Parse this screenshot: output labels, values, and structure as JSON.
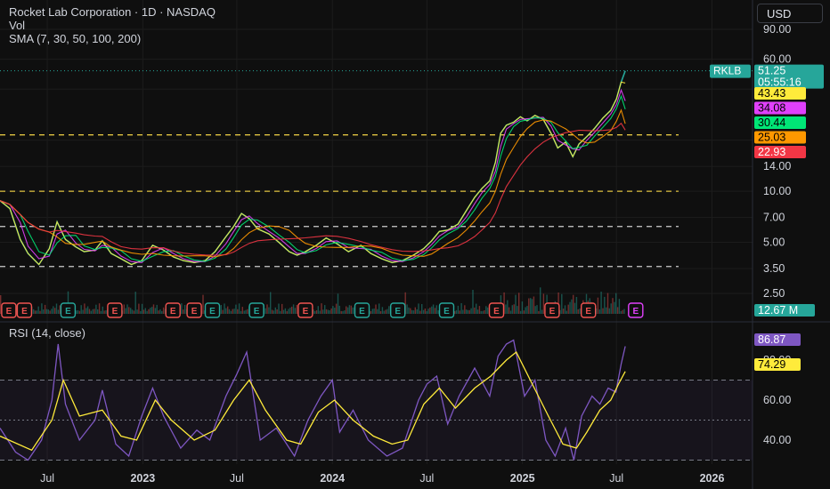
{
  "header": {
    "title": "Rocket Lab Corporation · 1D · NASDAQ",
    "vol_label": "Vol",
    "sma_label": "SMA (7, 30, 50, 100, 200)",
    "currency": "USD"
  },
  "rsi_title": "RSI (14, close)",
  "colors": {
    "up": "#26a69a",
    "down": "#ef5350",
    "sma7": "#ffeb3b",
    "sma30": "#e040fb",
    "sma50": "#00e676",
    "sma100": "#ff9800",
    "sma200": "#f23645",
    "rsi": "#7e57c2",
    "rsi_ma": "#ffeb3b"
  },
  "chart_data": [
    {
      "type": "line",
      "log_scale": true,
      "price_ticks": [
        "90.00",
        "60.00",
        "40.00",
        "20.00",
        "14.00",
        "10.00",
        "7.00",
        "5.00",
        "3.50",
        "2.50"
      ],
      "price_tick_values": [
        90,
        60,
        40,
        20,
        14,
        10,
        7,
        5,
        3.5,
        2.5
      ],
      "ylim": [
        2.5,
        90
      ],
      "x_ticks": [
        "Jul",
        "2023",
        "Jul",
        "2024",
        "Jul",
        "2025",
        "Jul",
        "2026"
      ],
      "x_tick_dates": [
        "2022-07-01",
        "2023-01-01",
        "2023-07-01",
        "2024-01-01",
        "2024-07-01",
        "2025-01-01",
        "2025-07-01",
        "2026-01-01"
      ],
      "xlim": [
        "2022-04-01",
        "2026-03-20"
      ],
      "series": [
        {
          "name": "RKLB",
          "points": [
            [
              "2022-04-01",
              8.8
            ],
            [
              "2022-04-20",
              7.9
            ],
            [
              "2022-05-10",
              5.2
            ],
            [
              "2022-05-25",
              4.3
            ],
            [
              "2022-06-15",
              3.7
            ],
            [
              "2022-07-05",
              4.6
            ],
            [
              "2022-07-20",
              6.6
            ],
            [
              "2022-08-05",
              5.2
            ],
            [
              "2022-08-25",
              4.7
            ],
            [
              "2022-09-10",
              4.4
            ],
            [
              "2022-10-01",
              4.5
            ],
            [
              "2022-10-15",
              5.1
            ],
            [
              "2022-11-01",
              4.3
            ],
            [
              "2022-11-20",
              4.0
            ],
            [
              "2022-12-10",
              3.7
            ],
            [
              "2022-12-30",
              3.9
            ],
            [
              "2023-01-20",
              4.8
            ],
            [
              "2023-02-10",
              4.5
            ],
            [
              "2023-03-01",
              4.1
            ],
            [
              "2023-03-20",
              3.9
            ],
            [
              "2023-04-10",
              3.8
            ],
            [
              "2023-05-01",
              3.9
            ],
            [
              "2023-05-20",
              4.4
            ],
            [
              "2023-06-10",
              5.4
            ],
            [
              "2023-06-25",
              6.2
            ],
            [
              "2023-07-10",
              7.4
            ],
            [
              "2023-07-25",
              6.9
            ],
            [
              "2023-08-10",
              6.0
            ],
            [
              "2023-09-01",
              5.6
            ],
            [
              "2023-09-20",
              5.0
            ],
            [
              "2023-10-10",
              4.4
            ],
            [
              "2023-10-25",
              4.2
            ],
            [
              "2023-11-10",
              4.4
            ],
            [
              "2023-12-01",
              4.8
            ],
            [
              "2023-12-20",
              5.3
            ],
            [
              "2024-01-10",
              4.9
            ],
            [
              "2024-02-01",
              4.4
            ],
            [
              "2024-02-25",
              4.8
            ],
            [
              "2024-03-15",
              4.3
            ],
            [
              "2024-04-05",
              4.0
            ],
            [
              "2024-04-25",
              3.8
            ],
            [
              "2024-05-15",
              3.9
            ],
            [
              "2024-06-05",
              4.2
            ],
            [
              "2024-06-25",
              4.6
            ],
            [
              "2024-07-10",
              5.1
            ],
            [
              "2024-07-25",
              5.8
            ],
            [
              "2024-08-10",
              5.9
            ],
            [
              "2024-08-30",
              6.4
            ],
            [
              "2024-09-15",
              7.7
            ],
            [
              "2024-10-01",
              9.2
            ],
            [
              "2024-10-15",
              10.4
            ],
            [
              "2024-10-30",
              11.5
            ],
            [
              "2024-11-10",
              14.8
            ],
            [
              "2024-11-20",
              22.0
            ],
            [
              "2024-12-01",
              24.5
            ],
            [
              "2024-12-15",
              25.5
            ],
            [
              "2024-12-28",
              27.5
            ],
            [
              "2025-01-10",
              26.0
            ],
            [
              "2025-01-25",
              28.0
            ],
            [
              "2025-02-10",
              26.5
            ],
            [
              "2025-02-25",
              22.0
            ],
            [
              "2025-03-10",
              18.0
            ],
            [
              "2025-03-25",
              19.5
            ],
            [
              "2025-04-08",
              16.0
            ],
            [
              "2025-04-20",
              19.0
            ],
            [
              "2025-05-05",
              21.0
            ],
            [
              "2025-05-20",
              23.5
            ],
            [
              "2025-06-05",
              27.0
            ],
            [
              "2025-06-20",
              30.0
            ],
            [
              "2025-07-01",
              35.0
            ],
            [
              "2025-07-10",
              44.0
            ],
            [
              "2025-07-18",
              51.25
            ]
          ]
        }
      ],
      "sma_labels": [
        {
          "name": "SMA 7",
          "text": "43.43",
          "value": 43.43
        },
        {
          "name": "SMA 30",
          "text": "34.08",
          "value": 34.08
        },
        {
          "name": "SMA 50",
          "text": "30.44",
          "value": 30.44
        },
        {
          "name": "SMA 100",
          "text": "25.03",
          "value": 25.03
        },
        {
          "name": "SMA 200",
          "text": "22.93",
          "value": 22.93
        }
      ],
      "last_price": {
        "symbol": "RKLB",
        "text": "51.25",
        "value": 51.25,
        "countdown": "05:55:16"
      },
      "support_levels": [
        21.5,
        10.0,
        6.2,
        3.6
      ],
      "volume_label": "12.67 M",
      "earnings_markers": [
        {
          "date": "2022-04-18",
          "label": "E",
          "type": "down"
        },
        {
          "date": "2022-05-18",
          "label": "E",
          "type": "down"
        },
        {
          "date": "2022-08-10",
          "label": "E",
          "type": "up"
        },
        {
          "date": "2022-11-08",
          "label": "E",
          "type": "down"
        },
        {
          "date": "2023-02-28",
          "label": "E",
          "type": "down"
        },
        {
          "date": "2023-04-10",
          "label": "E",
          "type": "down"
        },
        {
          "date": "2023-05-15",
          "label": "E",
          "type": "up"
        },
        {
          "date": "2023-08-08",
          "label": "E",
          "type": "up"
        },
        {
          "date": "2023-11-10",
          "label": "E",
          "type": "down"
        },
        {
          "date": "2024-02-27",
          "label": "E",
          "type": "up"
        },
        {
          "date": "2024-05-06",
          "label": "E",
          "type": "up"
        },
        {
          "date": "2024-08-08",
          "label": "E",
          "type": "up"
        },
        {
          "date": "2024-11-12",
          "label": "E",
          "type": "down"
        },
        {
          "date": "2025-02-27",
          "label": "E",
          "type": "down"
        },
        {
          "date": "2025-05-08",
          "label": "E",
          "type": "down"
        },
        {
          "date": "2025-08-07",
          "label": "E",
          "type": "next"
        }
      ]
    },
    {
      "type": "line",
      "title": "RSI (14, close)",
      "rsi_ticks": [
        "80.00",
        "60.00",
        "40.00"
      ],
      "rsi_tick_values": [
        80,
        60,
        40
      ],
      "ylim": [
        28,
        92
      ],
      "bands": [
        70,
        50,
        30
      ],
      "series": [
        {
          "name": "RSI",
          "points": [
            [
              "2022-04-01",
              46
            ],
            [
              "2022-05-01",
              34
            ],
            [
              "2022-05-25",
              30
            ],
            [
              "2022-06-20",
              40
            ],
            [
              "2022-07-10",
              60
            ],
            [
              "2022-07-22",
              88
            ],
            [
              "2022-08-05",
              58
            ],
            [
              "2022-09-01",
              40
            ],
            [
              "2022-10-01",
              50
            ],
            [
              "2022-10-15",
              65
            ],
            [
              "2022-11-10",
              38
            ],
            [
              "2022-12-05",
              32
            ],
            [
              "2022-12-30",
              52
            ],
            [
              "2023-01-20",
              66
            ],
            [
              "2023-02-10",
              52
            ],
            [
              "2023-03-15",
              36
            ],
            [
              "2023-04-15",
              45
            ],
            [
              "2023-05-10",
              40
            ],
            [
              "2023-06-10",
              62
            ],
            [
              "2023-07-01",
              73
            ],
            [
              "2023-07-20",
              84
            ],
            [
              "2023-08-15",
              40
            ],
            [
              "2023-09-15",
              46
            ],
            [
              "2023-10-20",
              32
            ],
            [
              "2023-11-15",
              50
            ],
            [
              "2023-12-10",
              62
            ],
            [
              "2024-01-01",
              70
            ],
            [
              "2024-01-15",
              44
            ],
            [
              "2024-02-10",
              55
            ],
            [
              "2024-03-10",
              40
            ],
            [
              "2024-04-15",
              32
            ],
            [
              "2024-05-15",
              36
            ],
            [
              "2024-06-15",
              60
            ],
            [
              "2024-07-01",
              68
            ],
            [
              "2024-07-20",
              72
            ],
            [
              "2024-08-10",
              48
            ],
            [
              "2024-09-01",
              62
            ],
            [
              "2024-10-01",
              76
            ],
            [
              "2024-10-30",
              62
            ],
            [
              "2024-11-15",
              82
            ],
            [
              "2024-12-01",
              88
            ],
            [
              "2024-12-15",
              90
            ],
            [
              "2025-01-05",
              62
            ],
            [
              "2025-01-25",
              70
            ],
            [
              "2025-02-15",
              40
            ],
            [
              "2025-03-05",
              32
            ],
            [
              "2025-03-25",
              46
            ],
            [
              "2025-04-10",
              30
            ],
            [
              "2025-04-25",
              52
            ],
            [
              "2025-05-15",
              62
            ],
            [
              "2025-05-30",
              58
            ],
            [
              "2025-06-15",
              66
            ],
            [
              "2025-06-30",
              64
            ],
            [
              "2025-07-10",
              78
            ],
            [
              "2025-07-18",
              86.87
            ]
          ]
        },
        {
          "name": "RSI MA",
          "points": [
            [
              "2022-04-01",
              42
            ],
            [
              "2022-06-01",
              35
            ],
            [
              "2022-07-10",
              50
            ],
            [
              "2022-08-01",
              70
            ],
            [
              "2022-09-01",
              52
            ],
            [
              "2022-10-15",
              55
            ],
            [
              "2022-11-20",
              42
            ],
            [
              "2022-12-20",
              40
            ],
            [
              "2023-01-25",
              60
            ],
            [
              "2023-02-25",
              50
            ],
            [
              "2023-04-10",
              40
            ],
            [
              "2023-05-20",
              45
            ],
            [
              "2023-06-25",
              60
            ],
            [
              "2023-07-25",
              70
            ],
            [
              "2023-08-25",
              55
            ],
            [
              "2023-10-05",
              40
            ],
            [
              "2023-11-01",
              38
            ],
            [
              "2023-12-05",
              54
            ],
            [
              "2024-01-05",
              60
            ],
            [
              "2024-02-10",
              50
            ],
            [
              "2024-03-20",
              42
            ],
            [
              "2024-04-25",
              38
            ],
            [
              "2024-05-25",
              40
            ],
            [
              "2024-06-25",
              58
            ],
            [
              "2024-07-25",
              66
            ],
            [
              "2024-08-25",
              56
            ],
            [
              "2024-10-01",
              66
            ],
            [
              "2024-11-01",
              72
            ],
            [
              "2024-12-01",
              80
            ],
            [
              "2024-12-20",
              84
            ],
            [
              "2025-01-20",
              68
            ],
            [
              "2025-02-20",
              52
            ],
            [
              "2025-03-20",
              38
            ],
            [
              "2025-04-15",
              36
            ],
            [
              "2025-05-05",
              44
            ],
            [
              "2025-05-30",
              55
            ],
            [
              "2025-06-20",
              60
            ],
            [
              "2025-07-05",
              68
            ],
            [
              "2025-07-18",
              74.29
            ]
          ]
        }
      ],
      "last_values": [
        {
          "name": "RSI",
          "text": "86.87",
          "value": 86.87
        },
        {
          "name": "RSI MA",
          "text": "74.29",
          "value": 74.29
        }
      ]
    }
  ]
}
